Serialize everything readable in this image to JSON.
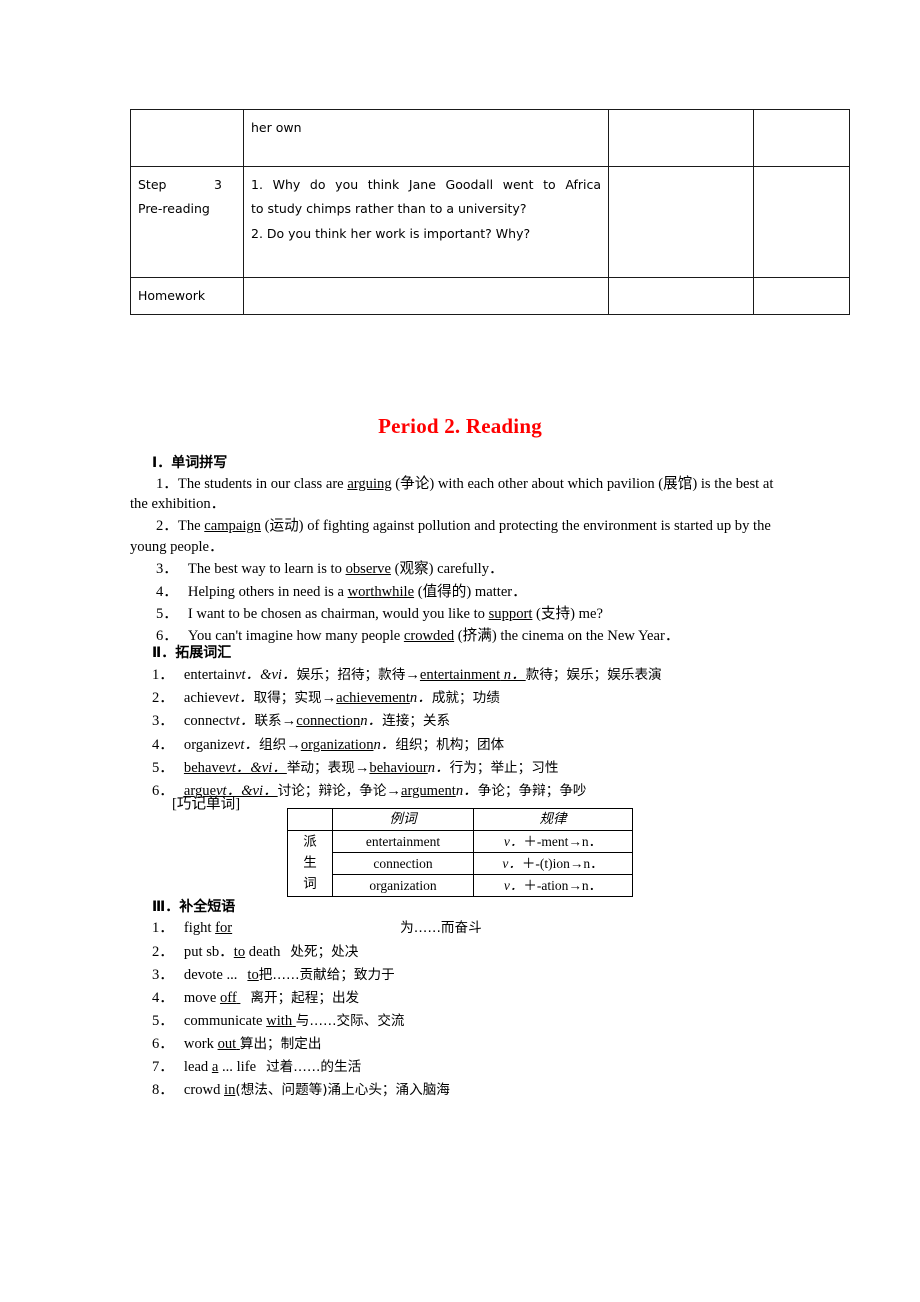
{
  "plan_table": {
    "rows": [
      {
        "col1": "",
        "col2_lines": [
          "her own"
        ],
        "col3": "",
        "col4": ""
      },
      {
        "col1_step": "Step",
        "col1_num": "3",
        "col1_sub": "Pre-reading",
        "col2_lines": [
          "1. Why do you think Jane Goodall went to Africa",
          "to study chimps rather than to a university?",
          "2. Do you think her work is important? Why?"
        ],
        "col3": "",
        "col4": ""
      },
      {
        "col1": "Homework",
        "col2_lines": [],
        "col3": "",
        "col4": ""
      }
    ]
  },
  "period_title": "Period 2. Reading",
  "colors": {
    "title_red": "#FF0000",
    "text_black": "#000000",
    "table_border": "#1a1a1a"
  },
  "section1": {
    "heading": "Ⅰ．单词拼写",
    "items": [
      {
        "num": "1．",
        "pre": "The students in our class are ",
        "answer": "arguing",
        "post": " (争论) with each other about which pavilion (展馆) is the best at the exhibition．"
      },
      {
        "num": "2．",
        "pre": "The ",
        "answer": "campaign",
        "post": " (运动) of fighting against pollution and protecting the environment is started up by the young people．"
      },
      {
        "num": "3．",
        "pre": "The best way to learn is to ",
        "answer": "observe",
        "post": " (观察) carefully．"
      },
      {
        "num": "4．",
        "pre": "Helping others in need is a ",
        "answer": "worthwhile",
        "post": " (值得的) matter．"
      },
      {
        "num": "5．",
        "pre": "I want to be chosen as chairman, would you like to ",
        "answer": "support",
        "post": " (支持) me?"
      },
      {
        "num": "6．",
        "pre": "You can't imagine how many people ",
        "answer": "crowded",
        "post": " (挤满) the cinema on the New Year．"
      }
    ]
  },
  "section2": {
    "heading": "Ⅱ．拓展词汇",
    "items": [
      {
        "num": "1．",
        "word": "entertain",
        "pos": "vt．&vi．",
        "meaning": "娱乐；招待；款待",
        "arrow": "→",
        "derived": "entertainment",
        "derived_pos": " n．",
        "derived_meaning": "款待；娱乐；娱乐表演"
      },
      {
        "num": "2．",
        "word": "achieve",
        "pos": "vt．",
        "meaning": "取得；实现",
        "arrow": "→",
        "derived": "achievement",
        "derived_pos": "n．",
        "derived_meaning": "成就；功绩"
      },
      {
        "num": "3．",
        "word": "connect",
        "pos": "vt．",
        "meaning": "联系",
        "arrow": "→",
        "derived": "connection",
        "derived_pos": "n．",
        "derived_meaning": "连接；关系"
      },
      {
        "num": "4．",
        "word": "organize",
        "pos": "vt．",
        "meaning": "组织",
        "arrow": "→",
        "derived": "organization",
        "derived_pos": "n．",
        "derived_meaning": "组织；机构；团体"
      },
      {
        "num": "5．",
        "word": "behave",
        "pos": "vt．&vi．",
        "meaning": "举动；表现",
        "arrow": "→",
        "derived": "behaviour",
        "derived_pos": "n．",
        "derived_meaning": "行为；举止；习性"
      },
      {
        "num": "6．",
        "word": "argue",
        "pos": "vt．&vi．",
        "meaning": "讨论；辩论，争论",
        "arrow": "→",
        "derived": "argument",
        "derived_pos": "n．",
        "derived_meaning": "争论；争辩；争吵"
      }
    ]
  },
  "mnemonic": {
    "label": "[巧记单词]",
    "row_label": "派生词",
    "row_label_chars": [
      "派",
      "生",
      "词"
    ],
    "headers": [
      "",
      "例词",
      "规律"
    ],
    "rows": [
      {
        "word": "entertainment",
        "rule_v": "v．",
        "rule_rest": "＋-ment→n．"
      },
      {
        "word": "connection",
        "rule_v": "v．",
        "rule_rest": "＋-(t)ion→n．"
      },
      {
        "word": "organization",
        "rule_v": "v．",
        "rule_rest": "＋-ation→n．"
      }
    ]
  },
  "section3": {
    "heading": "Ⅲ．补全短语",
    "items": [
      {
        "num": "1．",
        "pre": "fight ",
        "answer": "for",
        "post": "",
        "gap": true,
        "meaning": "为……而奋斗"
      },
      {
        "num": "2．",
        "pre": "put sb．",
        "answer": "to",
        "post": " death",
        "gap": false,
        "meaning": "处死；处决"
      },
      {
        "num": "3．",
        "pre": "devote ...",
        "answer": "to",
        "post": "",
        "gap": false,
        "meaning": "把……贡献给；致力于"
      },
      {
        "num": "4．",
        "pre": "move ",
        "answer": "off",
        "post": "",
        "gap": false,
        "meaning": "离开；起程；出发"
      },
      {
        "num": "5．",
        "pre": "communicate ",
        "answer": "with",
        "post": "",
        "gap": false,
        "meaning": "与……交际、交流"
      },
      {
        "num": "6．",
        "pre": "work ",
        "answer": "out",
        "post": "",
        "gap": false,
        "meaning": "算出；制定出"
      },
      {
        "num": "7．",
        "pre": "lead ",
        "answer": "a",
        "post": " ...   life",
        "gap": false,
        "meaning": "过着……的生活"
      },
      {
        "num": "8．",
        "pre": "crowd ",
        "answer": "in",
        "post": "",
        "gap": false,
        "meaning": "(想法、问题等)涌上心头；涌入脑海"
      }
    ]
  }
}
